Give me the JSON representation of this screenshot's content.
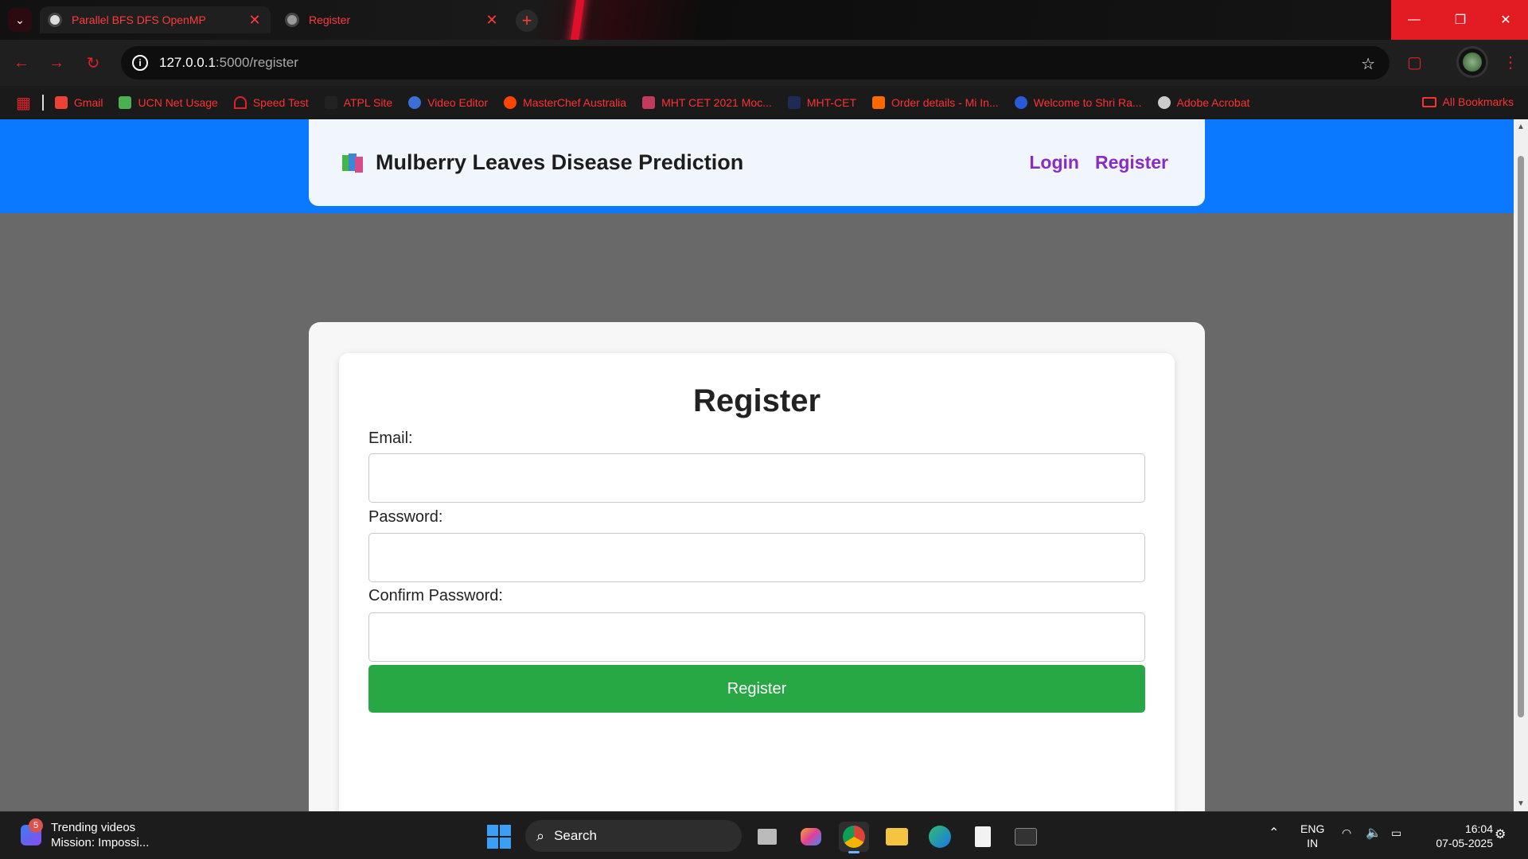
{
  "browser": {
    "tabs": [
      {
        "title": "Parallel BFS DFS OpenMP",
        "active": true
      },
      {
        "title": "Register",
        "active": false
      }
    ],
    "url": {
      "host": "127.0.0.1",
      "path": ":5000/register"
    },
    "bookmarks": [
      {
        "label": "Gmail",
        "icon": "gmail-icon",
        "color": "#ea4335"
      },
      {
        "label": "UCN Net Usage",
        "icon": "ucn-icon",
        "color": "#4caf50"
      },
      {
        "label": "Speed Test",
        "icon": "speedometer-icon",
        "color": "#e0202a"
      },
      {
        "label": "ATPL Site",
        "icon": "atpl-icon",
        "color": "#222222"
      },
      {
        "label": "Video Editor",
        "icon": "video-editor-icon",
        "color": "#3a6fd8"
      },
      {
        "label": "MasterChef Australia",
        "icon": "reddit-icon",
        "color": "#ff4500"
      },
      {
        "label": "MHT CET 2021 Moc...",
        "icon": "mht-cet-icon",
        "color": "#c23b5a"
      },
      {
        "label": "MHT-CET",
        "icon": "mht-icon",
        "color": "#1d2b55"
      },
      {
        "label": "Order details - Mi In...",
        "icon": "mi-icon",
        "color": "#ff6900"
      },
      {
        "label": "Welcome to Shri Ra...",
        "icon": "shri-icon",
        "color": "#2a5bd7"
      },
      {
        "label": "Adobe Acrobat",
        "icon": "globe-icon",
        "color": "#cccccc"
      }
    ],
    "all_bookmarks": "All Bookmarks"
  },
  "site": {
    "title": "Mulberry Leaves Disease Prediction",
    "nav": {
      "login": "Login",
      "register": "Register"
    }
  },
  "form": {
    "title": "Register",
    "email_label": "Email:",
    "email_value": "",
    "password_label": "Password:",
    "password_value": "",
    "confirm_label": "Confirm Password:",
    "confirm_value": "",
    "submit_label": "Register"
  },
  "taskbar": {
    "widget_badge": "5",
    "widget_title": "Trending videos",
    "widget_subtitle": "Mission: Impossi...",
    "search_label": "Search",
    "lang_line1": "ENG",
    "lang_line2": "IN",
    "time": "16:04",
    "date": "07-05-2025"
  },
  "colors": {
    "header_band": "#0a79ff",
    "nav_link": "#8a2bc4",
    "submit": "#28a745",
    "browser_accent": "#e0202a"
  }
}
